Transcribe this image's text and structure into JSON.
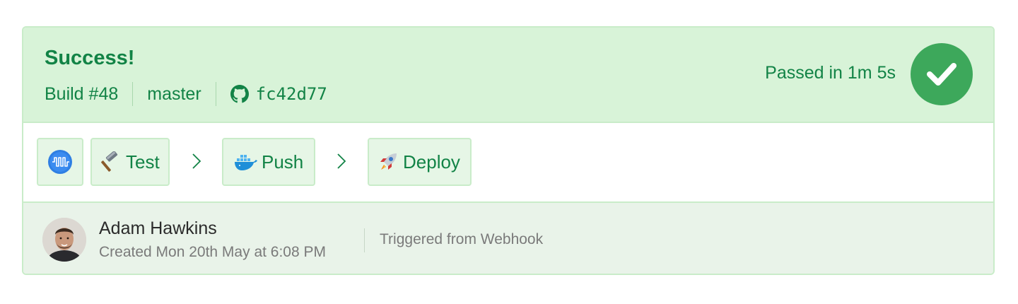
{
  "header": {
    "status_title": "Success!",
    "build_label": "Build #48",
    "branch": "master",
    "commit": "fc42d77",
    "duration_text": "Passed in 1m 5s",
    "status_icon": "check-icon",
    "accent_color": "#128346",
    "success_color": "#3da85b"
  },
  "pipeline": {
    "steps": [
      {
        "label": "",
        "icon": "pipeline-waveform-icon"
      },
      {
        "label": "Test",
        "icon": "hammer-icon"
      },
      {
        "label": "Push",
        "icon": "docker-whale-icon"
      },
      {
        "label": "Deploy",
        "icon": "rocket-icon"
      }
    ]
  },
  "footer": {
    "author_name": "Adam Hawkins",
    "created_text": "Created Mon 20th May at 6:08 PM",
    "trigger_text": "Triggered from Webhook"
  }
}
